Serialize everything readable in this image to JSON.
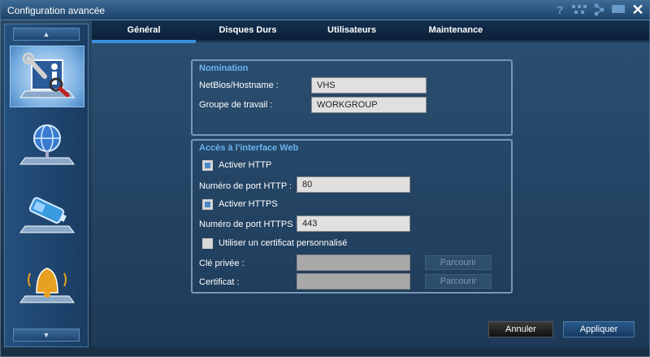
{
  "window": {
    "title": "Configuration avancée"
  },
  "titlebar_icons": [
    "help-icon",
    "network-icon",
    "share-icon",
    "screen-icon",
    "close-icon"
  ],
  "titlebar_labels": {
    "help": "?",
    "close": "✕"
  },
  "sidebar": {
    "up_arrow": "▲",
    "down_arrow": "▼",
    "items": [
      {
        "name": "general-settings",
        "icon": "tools-info-icon",
        "active": true
      },
      {
        "name": "network",
        "icon": "globe-icon",
        "active": false
      },
      {
        "name": "storage",
        "icon": "battery-icon",
        "active": false
      },
      {
        "name": "notifications",
        "icon": "bell-icon",
        "active": false
      }
    ]
  },
  "tabs": [
    {
      "label": "Général",
      "active": true
    },
    {
      "label": "Disques Durs",
      "active": false
    },
    {
      "label": "Utilisateurs",
      "active": false
    },
    {
      "label": "Maintenance",
      "active": false
    }
  ],
  "nomination": {
    "title": "Nomination",
    "netbios_label": "NetBios/Hostname :",
    "netbios_value": "VHS",
    "workgroup_label": "Groupe de travail :",
    "workgroup_value": "WORKGROUP"
  },
  "web": {
    "title": "Accès à l'interface Web",
    "http_enable_label": "Activer HTTP",
    "http_enabled": true,
    "http_port_label": "Numéro de port HTTP :",
    "http_port_value": "80",
    "https_enable_label": "Activer HTTPS",
    "https_enabled": true,
    "https_port_label": "Numéro de port HTTPS :",
    "https_port_value": "443",
    "custom_cert_label": "Utiliser un certificat personnalisé",
    "custom_cert_enabled": false,
    "private_key_label": "Clé privée :",
    "private_key_value": "",
    "certificate_label": "Certificat :",
    "certificate_value": "",
    "browse_label": "Parcourir"
  },
  "actions": {
    "cancel": "Annuler",
    "apply": "Appliquer"
  },
  "colors": {
    "accent": "#3a90e0",
    "group_title": "#6ab4f0"
  }
}
